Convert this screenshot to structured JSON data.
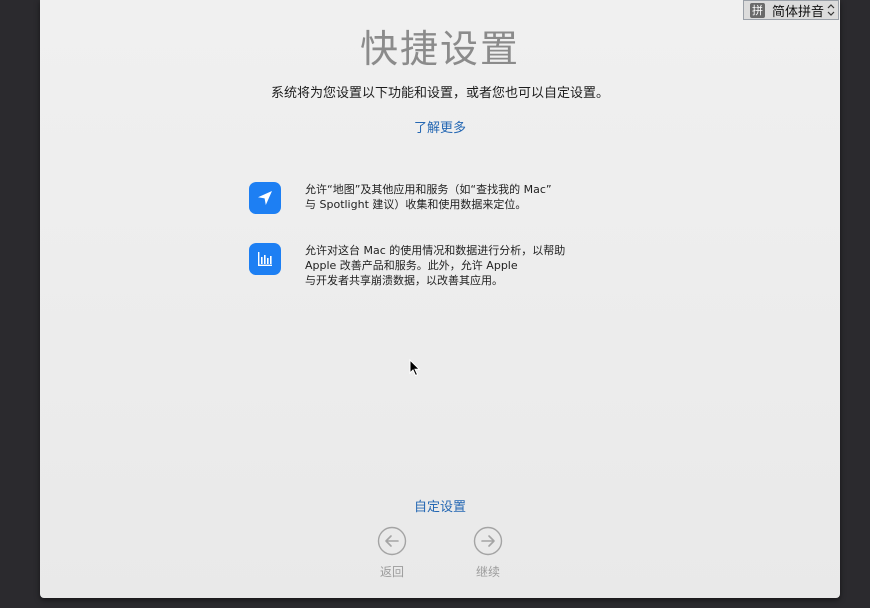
{
  "input_menu": {
    "icon_glyph": "拼",
    "label": "简体拼音"
  },
  "title": "快捷设置",
  "subtitle": "系统将为您设置以下功能和设置，或者您也可以自定设置。",
  "learn_more": "了解更多",
  "features": [
    {
      "icon": "location-arrow-icon",
      "lines": [
        "允许“地图”及其他应用和服务（如“查找我的 Mac”",
        "与 Spotlight 建议）收集和使用数据来定位。"
      ]
    },
    {
      "icon": "analytics-bars-icon",
      "lines": [
        "允许对这台 Mac 的使用情况和数据进行分析，以帮助",
        "Apple 改善产品和服务。此外，允许 Apple",
        "与开发者共享崩溃数据，以改善其应用。"
      ]
    }
  ],
  "custom_setup": "自定设置",
  "back_label": "返回",
  "continue_label": "继续",
  "colors": {
    "accent": "#1d7ff3",
    "link": "#2467b3",
    "title": "#8b8b8b",
    "background": "#2b2a2e"
  }
}
